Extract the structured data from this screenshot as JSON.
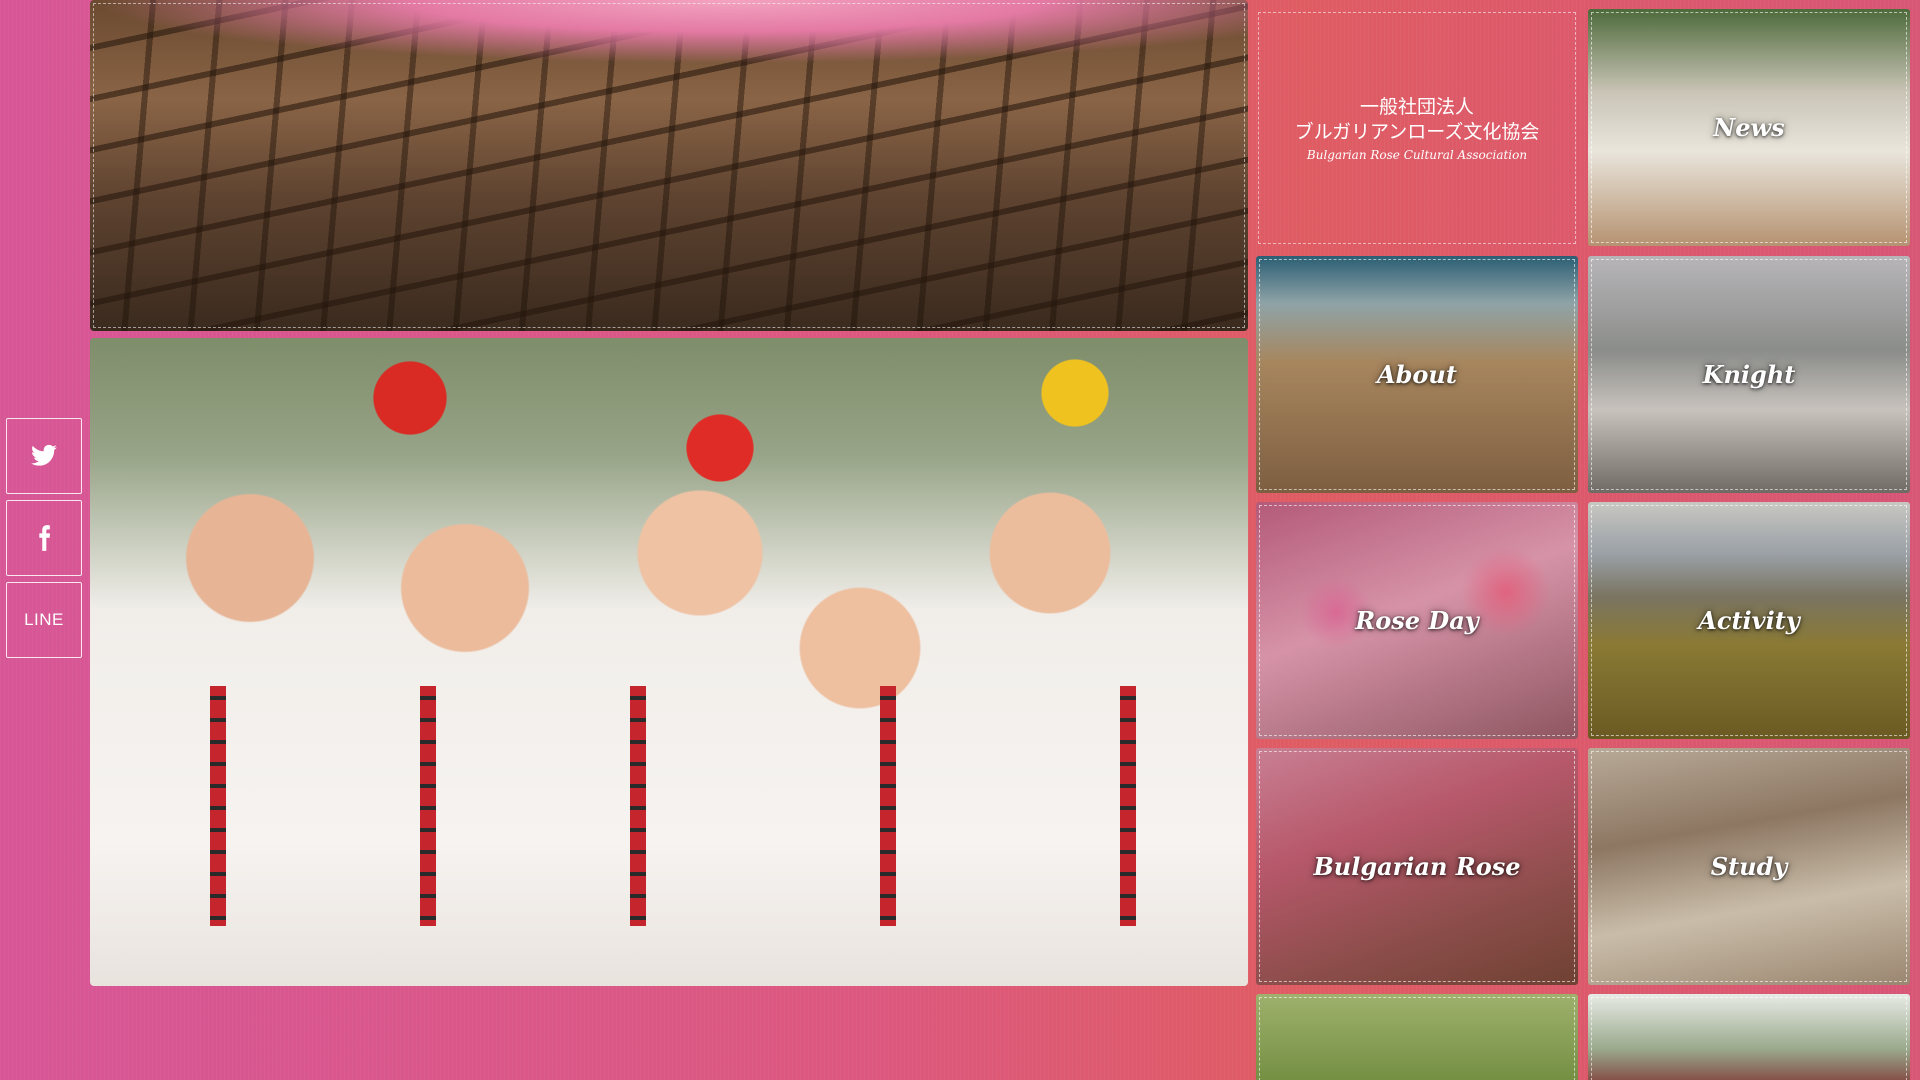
{
  "org": {
    "name_ja_line1": "一般社団法人",
    "name_ja_line2": "ブルガリアンローズ文化協会",
    "name_en": "Bulgarian Rose Cultural Association"
  },
  "share": {
    "twitter_icon": "twitter-icon",
    "facebook_icon": "facebook-icon",
    "line_label": "LINE"
  },
  "nav": {
    "tiles": [
      {
        "label": "News"
      },
      {
        "label": "About"
      },
      {
        "label": "Knight"
      },
      {
        "label": "Rose Day"
      },
      {
        "label": "Activity"
      },
      {
        "label": "Bulgarian Rose"
      },
      {
        "label": "Study"
      }
    ]
  },
  "colors": {
    "background_start": "#d75696",
    "background_end": "#df5c63",
    "text": "#ffffff"
  }
}
